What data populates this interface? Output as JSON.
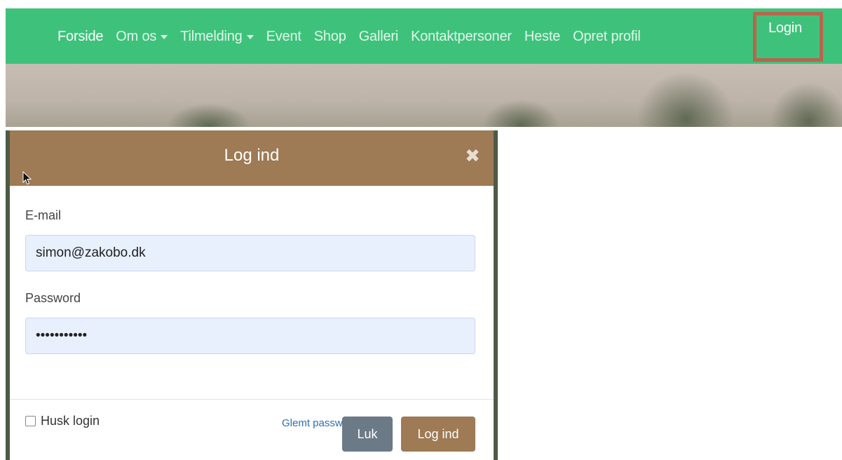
{
  "nav": {
    "items": [
      {
        "label": "Forside",
        "dropdown": false
      },
      {
        "label": "Om os",
        "dropdown": true
      },
      {
        "label": "Tilmelding",
        "dropdown": true
      },
      {
        "label": "Event",
        "dropdown": false
      },
      {
        "label": "Shop",
        "dropdown": false
      },
      {
        "label": "Galleri",
        "dropdown": false
      },
      {
        "label": "Kontaktpersoner",
        "dropdown": false
      },
      {
        "label": "Heste",
        "dropdown": false
      },
      {
        "label": "Opret profil",
        "dropdown": false
      }
    ],
    "login_label": "Login",
    "colors": {
      "bar": "#3ec27b",
      "highlight": "#b8654d"
    }
  },
  "modal": {
    "title": "Log ind",
    "close_icon": "close-icon",
    "email": {
      "label": "E-mail",
      "value": "simon@zakobo.dk"
    },
    "password": {
      "label": "Password",
      "value": "•••••••••••"
    },
    "remember_label": "Husk login",
    "forgot_label": "Glemt password?",
    "close_button": "Luk",
    "submit_button": "Log ind",
    "colors": {
      "header": "#9e7a55",
      "close_button": "#6b7a86",
      "link": "#2a6fb5"
    }
  }
}
